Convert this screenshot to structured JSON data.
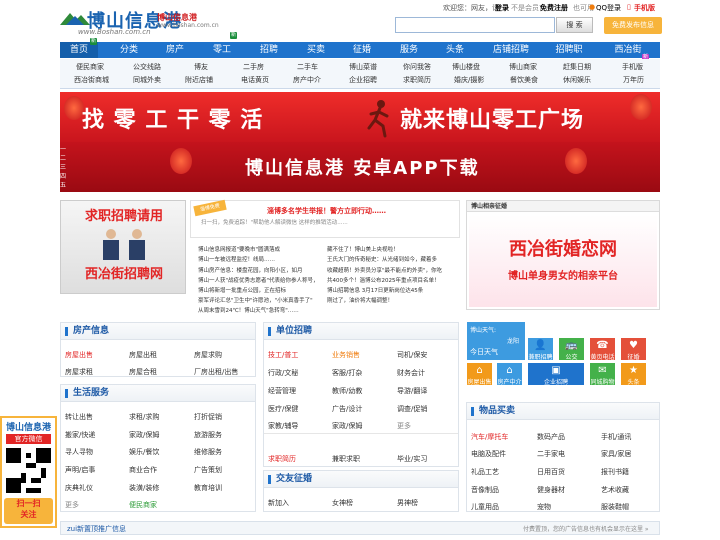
{
  "header": {
    "logo_title": "博山信息港",
    "logo_sub": "博山信息港",
    "logo_url": "www.Boshan.com.cn",
    "logo_url_small": "www.boshan.com.cn",
    "welcome": "欢迎您：网友，请",
    "login": "登录",
    "not_registered": "不是会员?",
    "free_register": "免费注册",
    "qq_text": "也可用",
    "qq_login": "QQ登录",
    "mobile": "手机版",
    "search_button": "搜 索",
    "search_placeholder": "",
    "post_button": "免费发布信息"
  },
  "nav": {
    "items": [
      "首页",
      "分类",
      "房产",
      "零工",
      "招聘",
      "买卖",
      "征婚",
      "服务",
      "头条",
      "店铺招聘",
      "招聘职",
      "西冶街"
    ],
    "badge_home": "新",
    "badge_lg": "新",
    "badge_xy": "新"
  },
  "subnav": {
    "row1": [
      "便民商家",
      "公交线路",
      "博友",
      "二手房",
      "二手车",
      "博山菜谱",
      "你问我答",
      "博山楼盘",
      "博山商家",
      "博山商家",
      "赶集日期",
      "手机版"
    ],
    "row2": [
      "西冶街商城",
      "同城外卖",
      "附近店铺",
      "电话黄页",
      "房产中介",
      "企业招聘",
      "求职简历",
      "婚庆/摄影",
      "餐饮美食",
      "休闲娱乐",
      "万年历"
    ]
  },
  "banner1": {
    "left": "找 零 工 干 零 活",
    "right": "就来博山零工广场",
    "flag": "零工"
  },
  "banner2": {
    "text": "博山信息港  安卓APP下载",
    "badges": [
      "一",
      "二",
      "三",
      "四",
      "五"
    ]
  },
  "left_ad": {
    "line1": "求职招聘请用",
    "line2": "西冶街招聘网"
  },
  "notice": {
    "tag": "淄博免费",
    "title": "淄博多名学生举报！警方立即行动……",
    "desc1": "扫一扫，免费追踪！\"帮助他人解读微信 这样的推销活动......",
    "url": ""
  },
  "news": {
    "left": [
      "博山信息网报道\"要晚市\"圆满落成",
      "博山一车被远程监控！线局……",
      "博山房产信息：楼盘花园，向阳小区，如月",
      "博山一人获\"战疫优秀志愿者\"代表给你参人称号，",
      "博山将新增一批重点公园，正在招标",
      "豪军评论汇总\"卫生中\"许愿池，\"小米真香手了\"",
      "从周末雪到24℃！博山天气\"急转弯\"……"
    ],
    "right": [
      "藏不住了！博山美上央视啦！",
      "王氏大门的传奇秘史：从光绪到如今，藏着多",
      "收藏超萌！外卖员分享\"最不能点的外卖\"，你吃",
      "共400多个！淄博公布2025年重点项目名单！",
      "博山招聘信息 3月17日更新岗位达45条",
      "刚过了，油价将大幅调整！"
    ]
  },
  "right_box": {
    "title": "博山相亲征婚",
    "line1": "西冶街婚恋网",
    "line2": "博山单身男女的相亲平台"
  },
  "house": {
    "title": "房产信息",
    "rows": [
      [
        "房屋出售",
        "房屋出租",
        "房屋求购"
      ],
      [
        "房屋求租",
        "房屋合租",
        "厂房出租/出售"
      ]
    ]
  },
  "life": {
    "title": "生活服务",
    "rows": [
      [
        "转让出售",
        "求租/求购",
        "打折促销"
      ],
      [
        "搬家/快递",
        "家政/保姆",
        "旅游服务"
      ],
      [
        "寻人寻物",
        "娱乐/餐饮",
        "维修服务"
      ],
      [
        "声明/启事",
        "商业合作",
        "广告策划"
      ],
      [
        "庆典礼仪",
        "装潢/装修",
        "教育培训"
      ],
      [
        "更多",
        "便民商家",
        ""
      ]
    ]
  },
  "jobs": {
    "title": "单位招聘",
    "rows": [
      [
        "技工/普工",
        "业务销售",
        "司机/保安"
      ],
      [
        "行政/文秘",
        "客服/打杂",
        "财务会计"
      ],
      [
        "经营管理",
        "教师/幼教",
        "导游/翻译"
      ],
      [
        "医疗/保健",
        "广告/设计",
        "调查/促销"
      ],
      [
        "家教/辅导",
        "家政/保姆",
        "更多"
      ],
      [
        "求职简历",
        "兼职求职",
        "毕业/实习"
      ]
    ]
  },
  "dating": {
    "title": "交友征婚",
    "rows": [
      [
        "新加入",
        "女神榜",
        "男神榜"
      ]
    ]
  },
  "weather": {
    "title": "博山天气:",
    "today": "今日天气",
    "city": "龙阳"
  },
  "tiles": [
    {
      "label": "兼职招聘",
      "icon": "👤",
      "color": "#3d9be0"
    },
    {
      "label": "公交",
      "icon": "🚌",
      "color": "#44b14a"
    },
    {
      "label": "黄页电话",
      "icon": "☎",
      "color": "#e4503a"
    },
    {
      "label": "征婚",
      "icon": "♥",
      "color": "#e4503a"
    },
    {
      "label": "房屋出售",
      "icon": "⌂",
      "color": "#f29a1a"
    },
    {
      "label": "房产中介",
      "icon": "⌂",
      "color": "#3d9be0"
    },
    {
      "label": "企业招聘",
      "icon": "▣",
      "color": "#1f73cc"
    },
    {
      "label": "同城购物",
      "icon": "✉",
      "color": "#44b14a"
    },
    {
      "label": "头条",
      "icon": "★",
      "color": "#f29a1a"
    }
  ],
  "goods": {
    "title": "物品买卖",
    "rows": [
      [
        "汽车/摩托车",
        "数码产品",
        "手机/通讯"
      ],
      [
        "电脑及配件",
        "二手家电",
        "家具/家居"
      ],
      [
        "礼品工艺",
        "日用百货",
        "报刊书籍"
      ],
      [
        "音像制品",
        "健身器材",
        "艺术收藏"
      ],
      [
        "儿童用品",
        "宠物",
        "服装鞋帽"
      ]
    ]
  },
  "qr": {
    "title": "博山信息港",
    "sub": "官方微信",
    "scan": "扫一扫",
    "follow": "关注"
  },
  "bottom": {
    "left": "zui新置顶推广信息",
    "right": "付费置顶，您的广告信息也有机会显示在这里 »"
  },
  "colors": {
    "brand": "#1f73cc",
    "accent": "#f7b43b",
    "red": "#e22525"
  }
}
